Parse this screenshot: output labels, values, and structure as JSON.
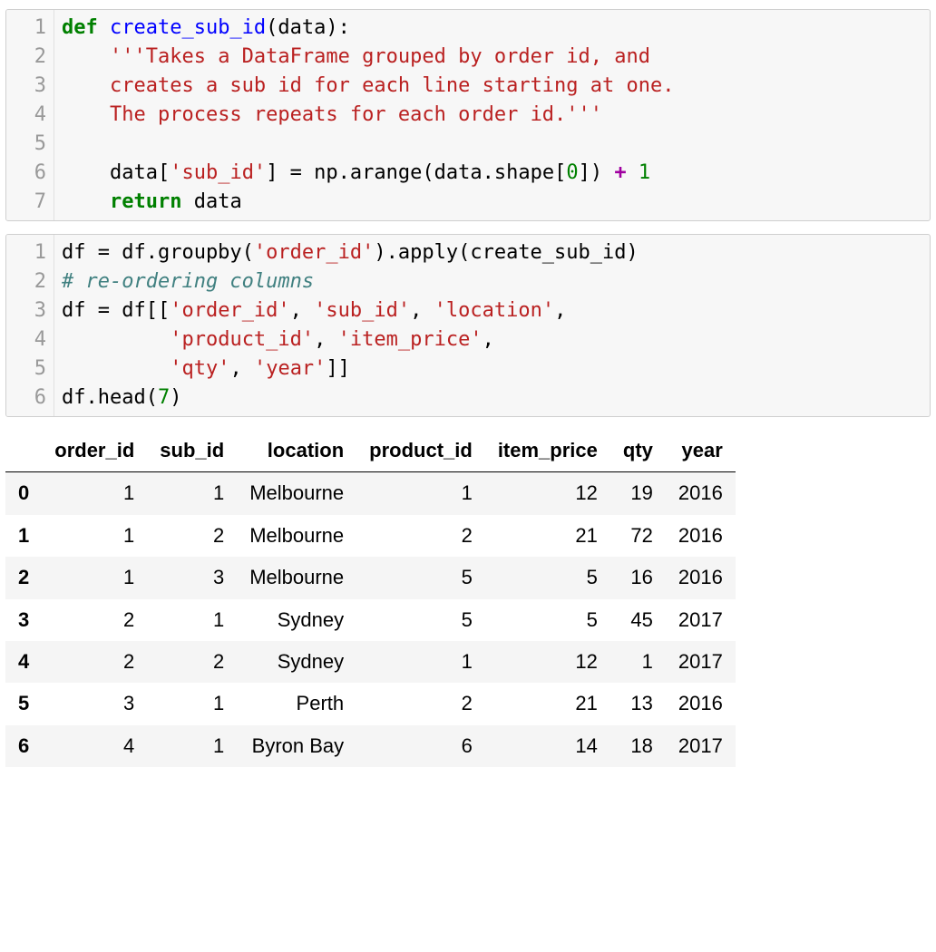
{
  "cells": [
    {
      "line_numbers": [
        "1",
        "2",
        "3",
        "4",
        "5",
        "6",
        "7"
      ],
      "lines": [
        [
          {
            "t": "def ",
            "c": "kw"
          },
          {
            "t": "create_sub_id",
            "c": "fn"
          },
          {
            "t": "(data):",
            "c": ""
          }
        ],
        [
          {
            "t": "    ",
            "c": ""
          },
          {
            "t": "'''Takes a DataFrame grouped by order id, and",
            "c": "str"
          }
        ],
        [
          {
            "t": "    ",
            "c": ""
          },
          {
            "t": "creates a sub id for each line starting at one.",
            "c": "str"
          }
        ],
        [
          {
            "t": "    ",
            "c": ""
          },
          {
            "t": "The process repeats for each order id.'''",
            "c": "str"
          }
        ],
        [
          {
            "t": "",
            "c": ""
          }
        ],
        [
          {
            "t": "    data[",
            "c": ""
          },
          {
            "t": "'sub_id'",
            "c": "str"
          },
          {
            "t": "] = np.arange(data.shape[",
            "c": ""
          },
          {
            "t": "0",
            "c": "num"
          },
          {
            "t": "]) ",
            "c": ""
          },
          {
            "t": "+",
            "c": "op"
          },
          {
            "t": " ",
            "c": ""
          },
          {
            "t": "1",
            "c": "num"
          }
        ],
        [
          {
            "t": "    ",
            "c": ""
          },
          {
            "t": "return",
            "c": "kw"
          },
          {
            "t": " data",
            "c": ""
          }
        ]
      ]
    },
    {
      "line_numbers": [
        "1",
        "2",
        "3",
        "4",
        "5",
        "6"
      ],
      "lines": [
        [
          {
            "t": "df = df.groupby(",
            "c": ""
          },
          {
            "t": "'order_id'",
            "c": "str"
          },
          {
            "t": ").apply(create_sub_id)",
            "c": ""
          }
        ],
        [
          {
            "t": "# re-ordering columns",
            "c": "cm"
          }
        ],
        [
          {
            "t": "df = df[[",
            "c": ""
          },
          {
            "t": "'order_id'",
            "c": "str"
          },
          {
            "t": ", ",
            "c": ""
          },
          {
            "t": "'sub_id'",
            "c": "str"
          },
          {
            "t": ", ",
            "c": ""
          },
          {
            "t": "'location'",
            "c": "str"
          },
          {
            "t": ",",
            "c": ""
          }
        ],
        [
          {
            "t": "         ",
            "c": ""
          },
          {
            "t": "'product_id'",
            "c": "str"
          },
          {
            "t": ", ",
            "c": ""
          },
          {
            "t": "'item_price'",
            "c": "str"
          },
          {
            "t": ",",
            "c": ""
          }
        ],
        [
          {
            "t": "         ",
            "c": ""
          },
          {
            "t": "'qty'",
            "c": "str"
          },
          {
            "t": ", ",
            "c": ""
          },
          {
            "t": "'year'",
            "c": "str"
          },
          {
            "t": "]]",
            "c": ""
          }
        ],
        [
          {
            "t": "df.head(",
            "c": ""
          },
          {
            "t": "7",
            "c": "num"
          },
          {
            "t": ")",
            "c": ""
          }
        ]
      ]
    }
  ],
  "dataframe": {
    "columns": [
      "order_id",
      "sub_id",
      "location",
      "product_id",
      "item_price",
      "qty",
      "year"
    ],
    "index": [
      "0",
      "1",
      "2",
      "3",
      "4",
      "5",
      "6"
    ],
    "rows": [
      [
        "1",
        "1",
        "Melbourne",
        "1",
        "12",
        "19",
        "2016"
      ],
      [
        "1",
        "2",
        "Melbourne",
        "2",
        "21",
        "72",
        "2016"
      ],
      [
        "1",
        "3",
        "Melbourne",
        "5",
        "5",
        "16",
        "2016"
      ],
      [
        "2",
        "1",
        "Sydney",
        "5",
        "5",
        "45",
        "2017"
      ],
      [
        "2",
        "2",
        "Sydney",
        "1",
        "12",
        "1",
        "2017"
      ],
      [
        "3",
        "1",
        "Perth",
        "2",
        "21",
        "13",
        "2016"
      ],
      [
        "4",
        "1",
        "Byron Bay",
        "6",
        "14",
        "18",
        "2017"
      ]
    ]
  }
}
